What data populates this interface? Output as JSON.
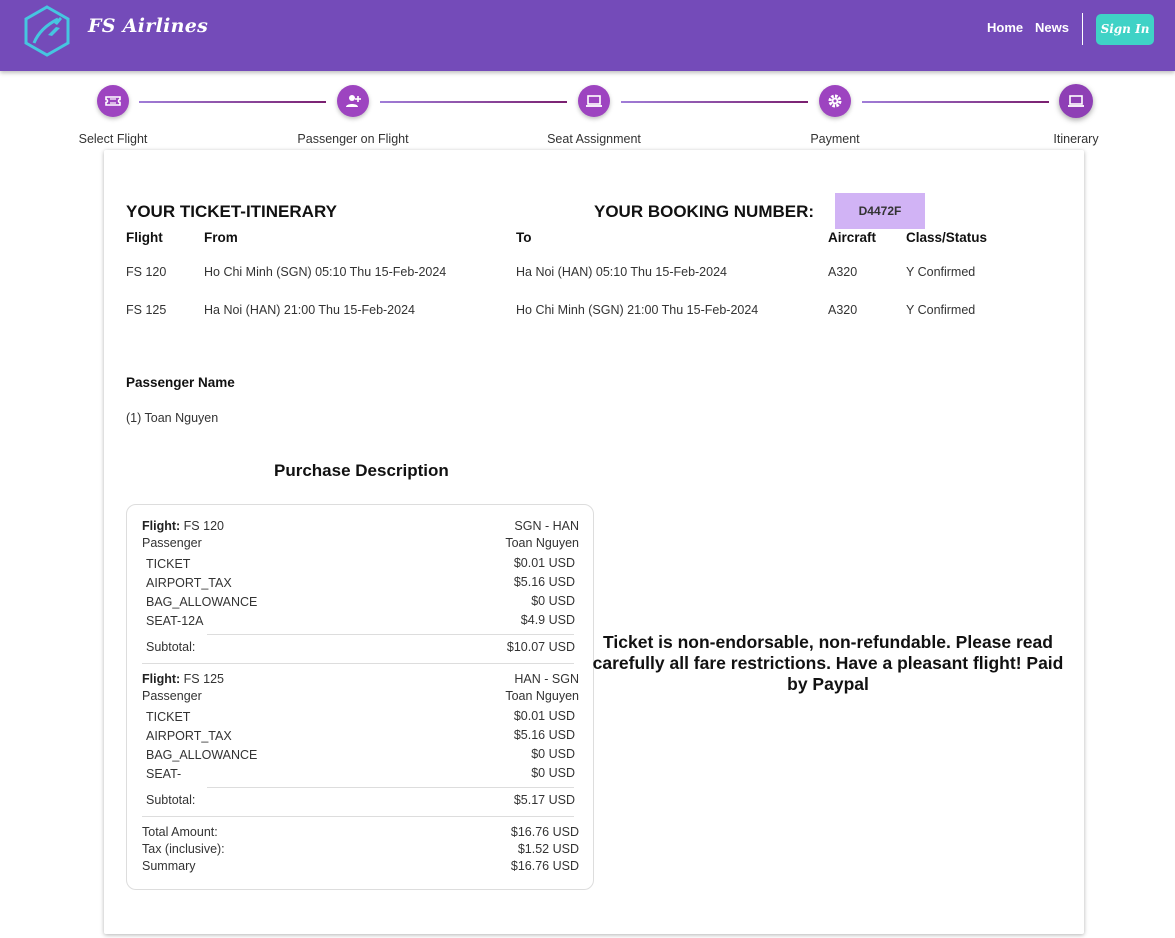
{
  "header": {
    "brand": "FS Airlines",
    "logo_icon": "plane-hexagon-logo-icon",
    "nav": {
      "home": "Home",
      "news": "News",
      "sign_in": "Sign In"
    },
    "colors": {
      "bar": "#744bb9",
      "sign_in": "#3fd2c6"
    }
  },
  "stepper": {
    "steps": [
      {
        "label": "Select Flight",
        "icon": "ticket-icon"
      },
      {
        "label": "Passenger on Flight",
        "icon": "person-add-icon"
      },
      {
        "label": "Seat Assignment",
        "icon": "laptop-icon"
      },
      {
        "label": "Payment",
        "icon": "gear-icon"
      },
      {
        "label": "Itinerary",
        "icon": "laptop-icon"
      }
    ],
    "active_index": 4,
    "step_color": "#9d44c0"
  },
  "itinerary": {
    "title": "YOUR TICKET-ITINERARY",
    "booking_label": "YOUR BOOKING NUMBER:",
    "booking_number": "D4472F",
    "booking_color": "#d1b3f5",
    "columns": [
      "Flight",
      "From",
      "To",
      "Aircraft",
      "Class/Status"
    ],
    "rows": [
      [
        "FS 120",
        "Ho Chi Minh (SGN) 05:10 Thu 15-Feb-2024",
        "Ha Noi (HAN) 05:10 Thu 15-Feb-2024",
        "A320",
        "Y Confirmed"
      ],
      [
        "FS 125",
        "Ha Noi (HAN) 21:00 Thu 15-Feb-2024",
        "Ho Chi Minh (SGN) 21:00 Thu 15-Feb-2024",
        "A320",
        "Y Confirmed"
      ]
    ]
  },
  "passengers": {
    "title": "Passenger Name",
    "list": [
      "(1) Toan Nguyen"
    ]
  },
  "purchase": {
    "title": "Purchase Description",
    "flight_label": "Flight:",
    "passenger_label": "Passenger",
    "subtotal_label": "Subtotal:",
    "flights": [
      {
        "flight": "FS 120",
        "route": "SGN - HAN",
        "passenger": "Toan Nguyen",
        "items": [
          {
            "name": "TICKET",
            "amount": "$0.01 USD"
          },
          {
            "name": "AIRPORT_TAX",
            "amount": "$5.16 USD"
          },
          {
            "name": "BAG_ALLOWANCE",
            "amount": "$0 USD"
          },
          {
            "name": "SEAT-12A",
            "amount": "$4.9 USD"
          }
        ],
        "subtotal": "$10.07 USD"
      },
      {
        "flight": "FS 125",
        "route": "HAN - SGN",
        "passenger": "Toan Nguyen",
        "items": [
          {
            "name": "TICKET",
            "amount": "$0.01 USD"
          },
          {
            "name": "AIRPORT_TAX",
            "amount": "$5.16 USD"
          },
          {
            "name": "BAG_ALLOWANCE",
            "amount": "$0 USD"
          },
          {
            "name": "SEAT-",
            "amount": "$0 USD"
          }
        ],
        "subtotal": "$5.17 USD"
      }
    ],
    "totals": [
      {
        "label": "Total Amount:",
        "value": "$16.76 USD"
      },
      {
        "label": "Tax (inclusive):",
        "value": "$1.52 USD"
      },
      {
        "label": "Summary",
        "value": "$16.76 USD"
      }
    ]
  },
  "note": "Ticket is non-endorsable, non-refundable. Please read carefully all fare restrictions. Have a pleasant flight! Paid by Paypal"
}
